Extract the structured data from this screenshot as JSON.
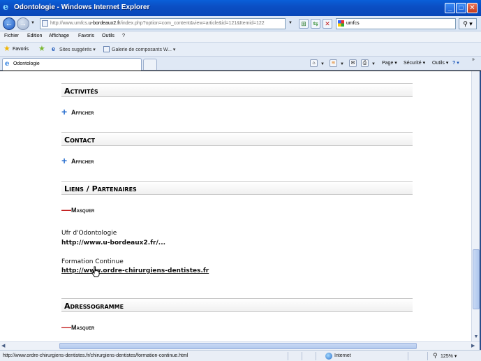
{
  "window": {
    "title": "Odontologie - Windows Internet Explorer",
    "minimize_glyph": "_",
    "maximize_glyph": "□",
    "close_glyph": "✕"
  },
  "address_bar": {
    "url_prefix": "http://www.umfcs.",
    "url_domain": "u-bordeaux2.fr",
    "url_suffix": "/index.php?option=com_content&view=article&id=121&Itemid=122",
    "back_glyph": "←",
    "forward_glyph": "→",
    "compat_glyph": "⊞",
    "refresh_glyph": "⇆",
    "stop_glyph": "✕",
    "search_value": "umfcs",
    "search_button_glyph": "⚲ ▾"
  },
  "menu": {
    "items": [
      "Fichier",
      "Edition",
      "Affichage",
      "Favoris",
      "Outils",
      "?"
    ]
  },
  "favorites_bar": {
    "favorites_label": "Favoris",
    "suggested_sites": "Sites suggérés ▾",
    "gallery": "Galerie de composants W... ▾"
  },
  "tabs": {
    "active_tab_label": "Odontologie"
  },
  "command_bar": {
    "page": "Page ▾",
    "security": "Sécurité ▾",
    "tools": "Outils ▾",
    "help": "? ▾",
    "overflow": "»"
  },
  "content": {
    "sections": {
      "activites": {
        "title": "Activités",
        "toggle": "Afficher",
        "toggle_symbol": "+"
      },
      "contact": {
        "title": "Contact",
        "toggle": "Afficher",
        "toggle_symbol": "+"
      },
      "liens": {
        "title": "Liens / Partenaires",
        "toggle": "Masquer",
        "toggle_symbol": "—"
      },
      "adressogramme": {
        "title": "Adressogramme",
        "toggle": "Masquer",
        "toggle_symbol": "—"
      }
    },
    "links": [
      {
        "label": "Ufr d'Odontologie",
        "url": "http://www.u-bordeaux2.fr/..."
      },
      {
        "label": "Formation Continue",
        "url": "http://www.ordre-chirurgiens-dentistes.fr"
      }
    ]
  },
  "status_bar": {
    "text": "http://www.ordre-chirurgiens-dentistes.fr/chirurgiens-dentistes/formation-continue.html",
    "zone": "Internet",
    "zoom": "125% ▾"
  }
}
